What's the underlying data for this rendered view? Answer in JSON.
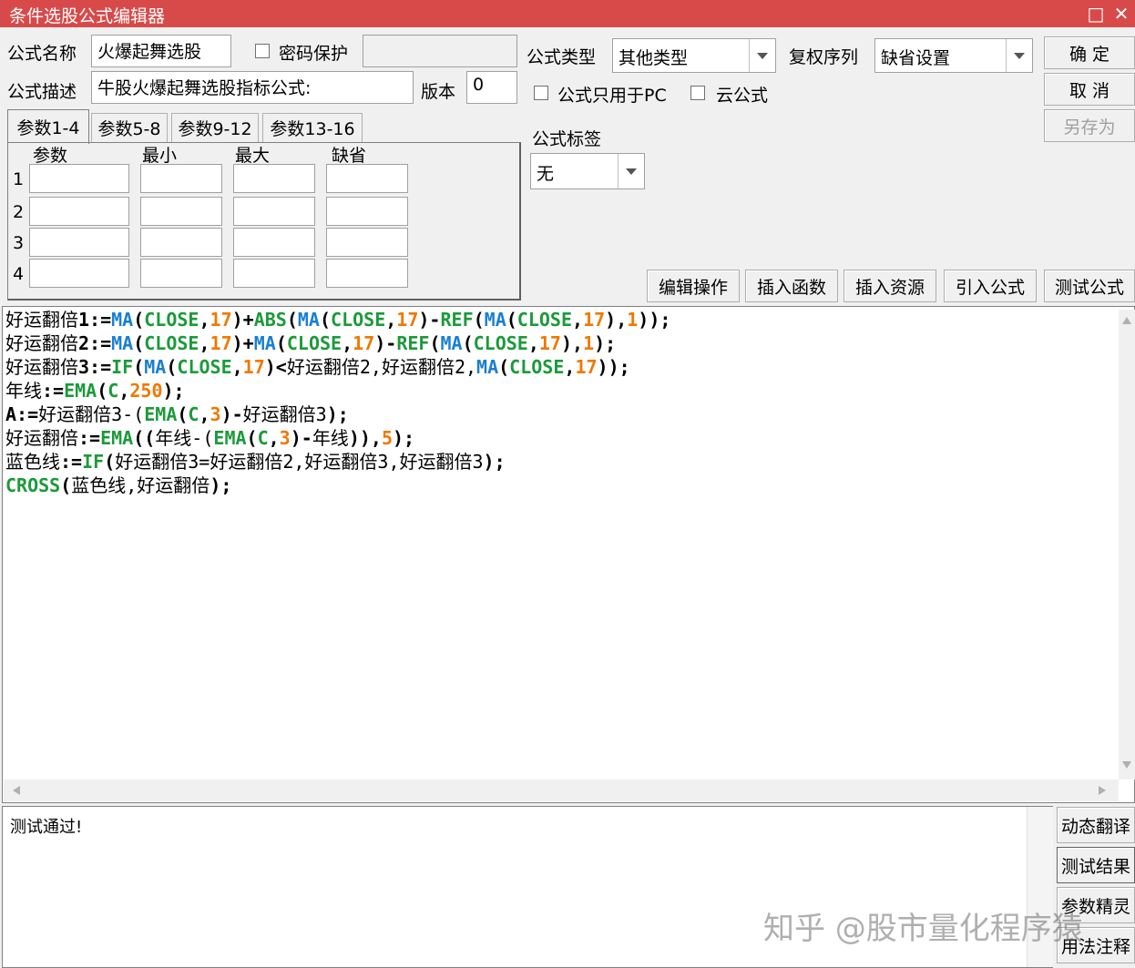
{
  "window": {
    "title": "条件选股公式编辑器",
    "maximize_icon": "□",
    "close_icon": "✕"
  },
  "form": {
    "name_label": "公式名称",
    "name_value": "火爆起舞选股",
    "password_label": "密码保护",
    "password_value": "",
    "desc_label": "公式描述",
    "desc_value": "牛股火爆起舞选股指标公式:",
    "version_label": "版本",
    "version_value": "0",
    "type_label": "公式类型",
    "type_value": "其他类型",
    "restore_label": "复权序列",
    "restore_value": "缺省设置",
    "pc_only_label": "公式只用于PC",
    "cloud_label": "云公式",
    "tag_label": "公式标签",
    "tag_value": "无"
  },
  "buttons": {
    "ok": "确 定",
    "cancel": "取 消",
    "save_as": "另存为"
  },
  "tabs": [
    "参数1-4",
    "参数5-8",
    "参数9-12",
    "参数13-16"
  ],
  "params": {
    "headers": [
      "参数",
      "最小",
      "最大",
      "缺省"
    ],
    "rows": [
      "1",
      "2",
      "3",
      "4"
    ]
  },
  "toolbar": {
    "edit": "编辑操作",
    "insert_func": "插入函数",
    "insert_res": "插入资源",
    "import": "引入公式",
    "test": "测试公式"
  },
  "code_lines": [
    [
      [
        "plain",
        "好运翻倍"
      ],
      [
        "op",
        "1:="
      ],
      [
        "kw",
        "MA"
      ],
      [
        "op",
        "("
      ],
      [
        "fn",
        "CLOSE"
      ],
      [
        "op",
        ","
      ],
      [
        "num",
        "17"
      ],
      [
        "op",
        ")+"
      ],
      [
        "fn",
        "ABS"
      ],
      [
        "op",
        "("
      ],
      [
        "kw",
        "MA"
      ],
      [
        "op",
        "("
      ],
      [
        "fn",
        "CLOSE"
      ],
      [
        "op",
        ","
      ],
      [
        "num",
        "17"
      ],
      [
        "op",
        ")-"
      ],
      [
        "fn",
        "REF"
      ],
      [
        "op",
        "("
      ],
      [
        "kw",
        "MA"
      ],
      [
        "op",
        "("
      ],
      [
        "fn",
        "CLOSE"
      ],
      [
        "op",
        ","
      ],
      [
        "num",
        "17"
      ],
      [
        "op",
        "),"
      ],
      [
        "num",
        "1"
      ],
      [
        "op",
        "));"
      ]
    ],
    [
      [
        "plain",
        "好运翻倍"
      ],
      [
        "op",
        "2:="
      ],
      [
        "kw",
        "MA"
      ],
      [
        "op",
        "("
      ],
      [
        "fn",
        "CLOSE"
      ],
      [
        "op",
        ","
      ],
      [
        "num",
        "17"
      ],
      [
        "op",
        ")+"
      ],
      [
        "kw",
        "MA"
      ],
      [
        "op",
        "("
      ],
      [
        "fn",
        "CLOSE"
      ],
      [
        "op",
        ","
      ],
      [
        "num",
        "17"
      ],
      [
        "op",
        ")-"
      ],
      [
        "fn",
        "REF"
      ],
      [
        "op",
        "("
      ],
      [
        "kw",
        "MA"
      ],
      [
        "op",
        "("
      ],
      [
        "fn",
        "CLOSE"
      ],
      [
        "op",
        ","
      ],
      [
        "num",
        "17"
      ],
      [
        "op",
        "),"
      ],
      [
        "num",
        "1"
      ],
      [
        "op",
        ");"
      ]
    ],
    [
      [
        "plain",
        "好运翻倍"
      ],
      [
        "op",
        "3:="
      ],
      [
        "fn",
        "IF"
      ],
      [
        "op",
        "("
      ],
      [
        "kw",
        "MA"
      ],
      [
        "op",
        "("
      ],
      [
        "fn",
        "CLOSE"
      ],
      [
        "op",
        ","
      ],
      [
        "num",
        "17"
      ],
      [
        "op",
        ")<"
      ],
      [
        "plain",
        "好运翻倍2,好运翻倍2,"
      ],
      [
        "kw",
        "MA"
      ],
      [
        "op",
        "("
      ],
      [
        "fn",
        "CLOSE"
      ],
      [
        "op",
        ","
      ],
      [
        "num",
        "17"
      ],
      [
        "op",
        "));"
      ]
    ],
    [
      [
        "plain",
        "年线"
      ],
      [
        "op",
        ":="
      ],
      [
        "fn",
        "EMA"
      ],
      [
        "op",
        "("
      ],
      [
        "fn",
        "C"
      ],
      [
        "op",
        ","
      ],
      [
        "num",
        "250"
      ],
      [
        "op",
        ");"
      ]
    ],
    [
      [
        "op",
        "A:="
      ],
      [
        "plain",
        "好运翻倍3-("
      ],
      [
        "fn",
        "EMA"
      ],
      [
        "op",
        "("
      ],
      [
        "fn",
        "C"
      ],
      [
        "op",
        ","
      ],
      [
        "num",
        "3"
      ],
      [
        "op",
        ")-"
      ],
      [
        "plain",
        "好运翻倍3"
      ],
      [
        "op",
        ");"
      ]
    ],
    [
      [
        "plain",
        "好运翻倍"
      ],
      [
        "op",
        ":="
      ],
      [
        "fn",
        "EMA"
      ],
      [
        "op",
        "(("
      ],
      [
        "plain",
        "年线-("
      ],
      [
        "fn",
        "EMA"
      ],
      [
        "op",
        "("
      ],
      [
        "fn",
        "C"
      ],
      [
        "op",
        ","
      ],
      [
        "num",
        "3"
      ],
      [
        "op",
        ")-"
      ],
      [
        "plain",
        "年线"
      ],
      [
        "op",
        "))"
      ],
      [
        "op",
        ","
      ],
      [
        "num",
        "5"
      ],
      [
        "op",
        ");"
      ]
    ],
    [
      [
        "plain",
        "蓝色线"
      ],
      [
        "op",
        ":="
      ],
      [
        "fn",
        "IF"
      ],
      [
        "op",
        "("
      ],
      [
        "plain",
        "好运翻倍3=好运翻倍2,好运翻倍3,好运翻倍3"
      ],
      [
        "op",
        ");"
      ]
    ],
    [
      [
        "fn",
        "CROSS"
      ],
      [
        "op",
        "("
      ],
      [
        "plain",
        "蓝色线,好运翻倍"
      ],
      [
        "op",
        ");"
      ]
    ]
  ],
  "output": {
    "message": "测试通过!"
  },
  "side_buttons": {
    "dynamic": "动态翻译",
    "result": "测试结果",
    "wizard": "参数精灵",
    "usage": "用法注释"
  },
  "watermark": "知乎 @股市量化程序猿",
  "colors": {
    "titlebar": "#d84a4a",
    "keyword": "#1a7fd1",
    "function": "#1c9a3a",
    "number": "#f07800"
  }
}
